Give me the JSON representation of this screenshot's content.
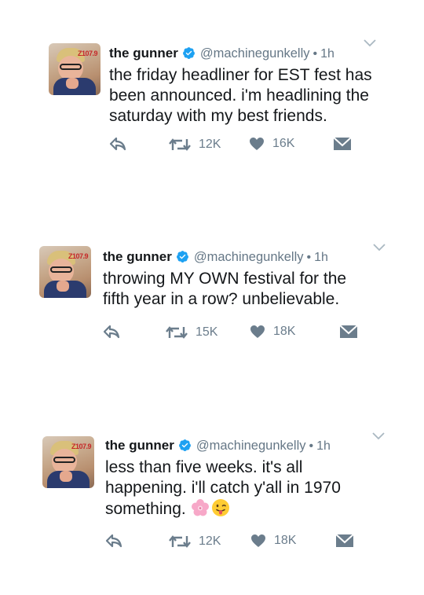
{
  "tweets": [
    {
      "name": "the gunner",
      "handle": "@machinegunkelly",
      "separator": "•",
      "time": "1h",
      "text": "the friday headliner for EST fest has been announced. i'm headlining the saturday with my best friends.",
      "retweets": "12K",
      "likes": "16K"
    },
    {
      "name": "the gunner",
      "handle": "@machinegunkelly",
      "separator": "•",
      "time": "1h",
      "text": "throwing MY OWN festival for the fifth year in a row? unbelievable.",
      "retweets": "15K",
      "likes": "18K"
    },
    {
      "name": "the gunner",
      "handle": "@machinegunkelly",
      "separator": "•",
      "time": "1h",
      "text": "less than five weeks. it's all happening. i'll catch y'all in 1970 something.",
      "retweets": "12K",
      "likes": "18K"
    }
  ],
  "avatar_logo_text": "Z107.9",
  "icons": {
    "verified": "verified-badge-icon",
    "chevron": "chevron-down-icon",
    "reply": "reply-icon",
    "retweet": "retweet-icon",
    "like": "heart-icon",
    "dm": "envelope-icon",
    "emoji_1": "cherry-blossom-emoji",
    "emoji_2": "tongue-face-emoji"
  },
  "colors": {
    "verified_blue": "#1da1f2",
    "text": "#14171a",
    "muted": "#657786",
    "action_gray": "#6b7d8c"
  }
}
